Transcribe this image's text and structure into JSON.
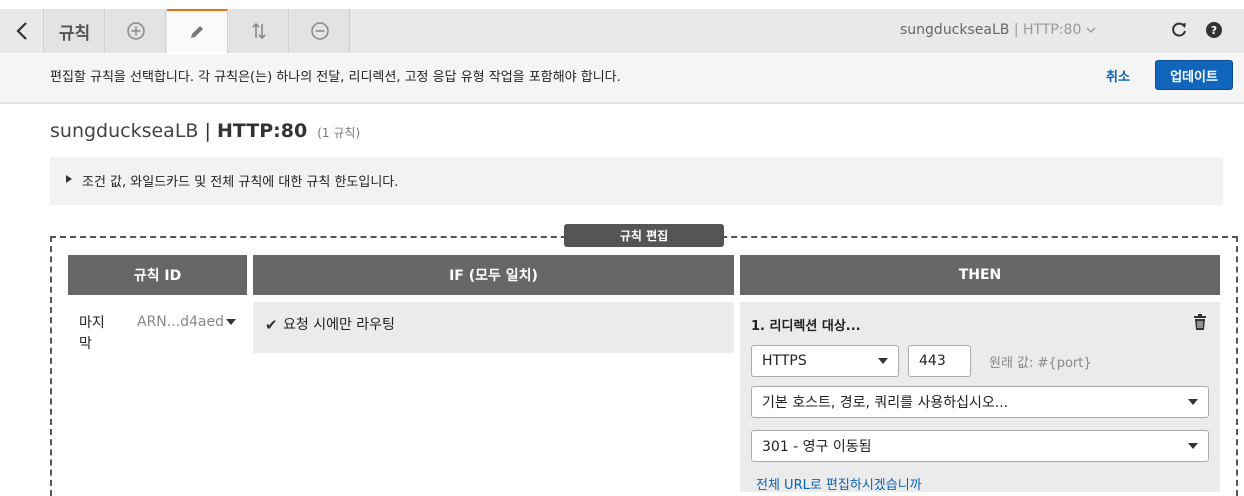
{
  "toolbar": {
    "rules_label": "규칙",
    "lb_name": "sungduckseaLB",
    "listener": "HTTP:80"
  },
  "infobar": {
    "message": "편집할 규칙을 선택합니다. 각 규칙은(는) 하나의 전달, 리디렉션, 고정 응답 유형 작업을 포함해야 합니다.",
    "cancel_label": "취소",
    "update_label": "업데이트"
  },
  "title": {
    "lb_name": "sungduckseaLB",
    "separator": "|",
    "listener": "HTTP:80",
    "rule_count": "(1 규칙)"
  },
  "limits": {
    "text": "조건 값, 와일드카드 및 전체 규칙에 대한 규칙 한도입니다."
  },
  "editor": {
    "label": "규칙 편집",
    "columns": [
      "규칙 ID",
      "IF (모두 일치)",
      "THEN"
    ],
    "rule": {
      "position": "마지막",
      "arn": "ARN...d4aed",
      "if_condition": "요청 시에만 라우팅",
      "then": {
        "title": "1. 리디렉션 대상...",
        "protocol": "HTTPS",
        "port": "443",
        "original_value": "원래 값: #{port}",
        "host_path_query": "기본 호스트, 경로, 쿼리를 사용하십시오...",
        "status_code": "301 - 영구 이동됨",
        "link_text": "전체 URL로 편집하시겠습니까"
      }
    }
  },
  "colors": {
    "accent_orange": "#ec7211",
    "primary_blue": "#1166bb",
    "header_gray": "#676767"
  }
}
